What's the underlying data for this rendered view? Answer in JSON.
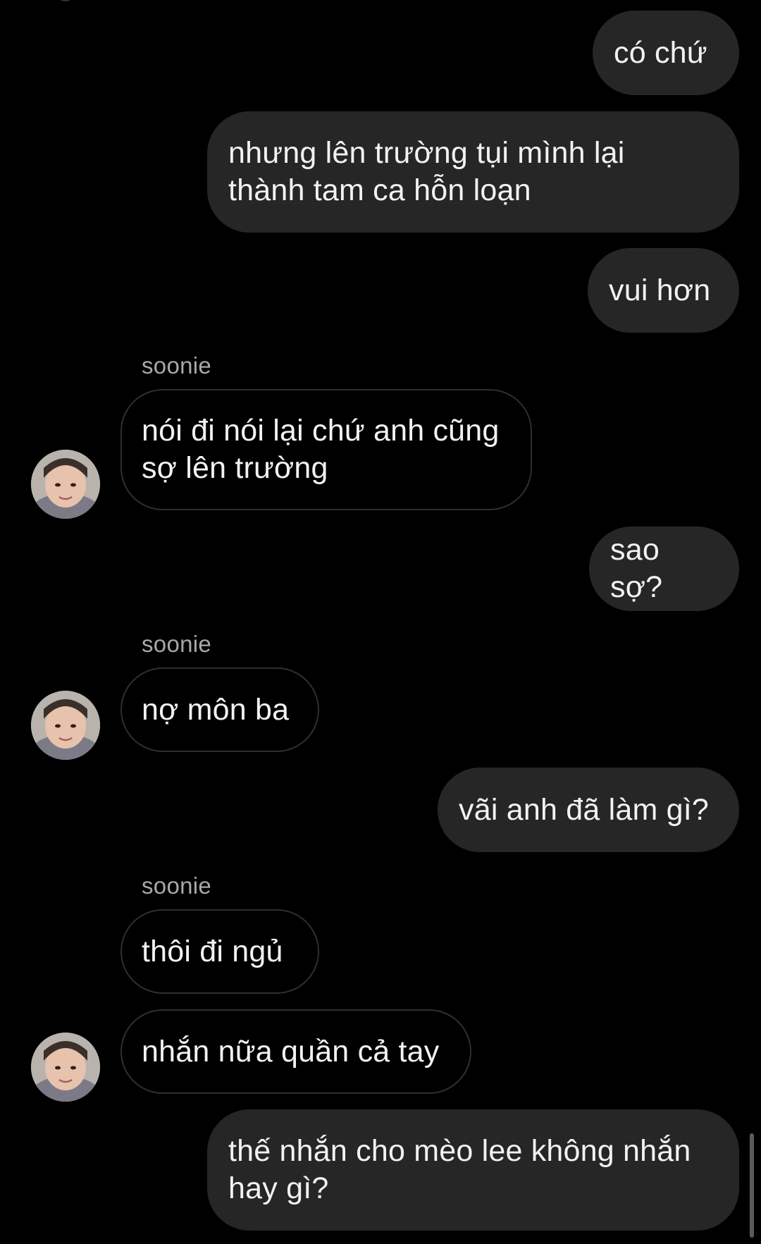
{
  "conversation": {
    "messages": [
      {
        "id": "m1",
        "from": "me",
        "text": "có chứ"
      },
      {
        "id": "m2",
        "from": "me",
        "text": "nhưng lên trường tụi mình lại\nthành tam ca hỗn loạn"
      },
      {
        "id": "m3",
        "from": "me",
        "text": "vui hơn"
      },
      {
        "id": "m4",
        "from": "soonie",
        "sender": "soonie",
        "text": "nói đi nói lại chứ anh cũng\nsợ lên trường"
      },
      {
        "id": "m5",
        "from": "me",
        "text": "sao sợ?"
      },
      {
        "id": "m6",
        "from": "soonie",
        "sender": "soonie",
        "text": "nợ môn ba"
      },
      {
        "id": "m7",
        "from": "me",
        "text": "vãi anh đã làm gì?"
      },
      {
        "id": "m8",
        "from": "soonie",
        "sender": "soonie",
        "text": "thôi đi ngủ"
      },
      {
        "id": "m9",
        "from": "soonie",
        "text": "nhắn nữa quần cả tay"
      },
      {
        "id": "m10",
        "from": "me",
        "text": "thế nhắn cho mèo lee không nhắn\nhay gì?"
      }
    ]
  },
  "theme": {
    "background": "#000000",
    "outgoing_bubble": "#262626",
    "incoming_border": "#2f2f2f",
    "text": "#f2f2f2",
    "sender_label": "#a8a8a8"
  },
  "icons": {
    "avatar": "profile-photo-avatar"
  }
}
